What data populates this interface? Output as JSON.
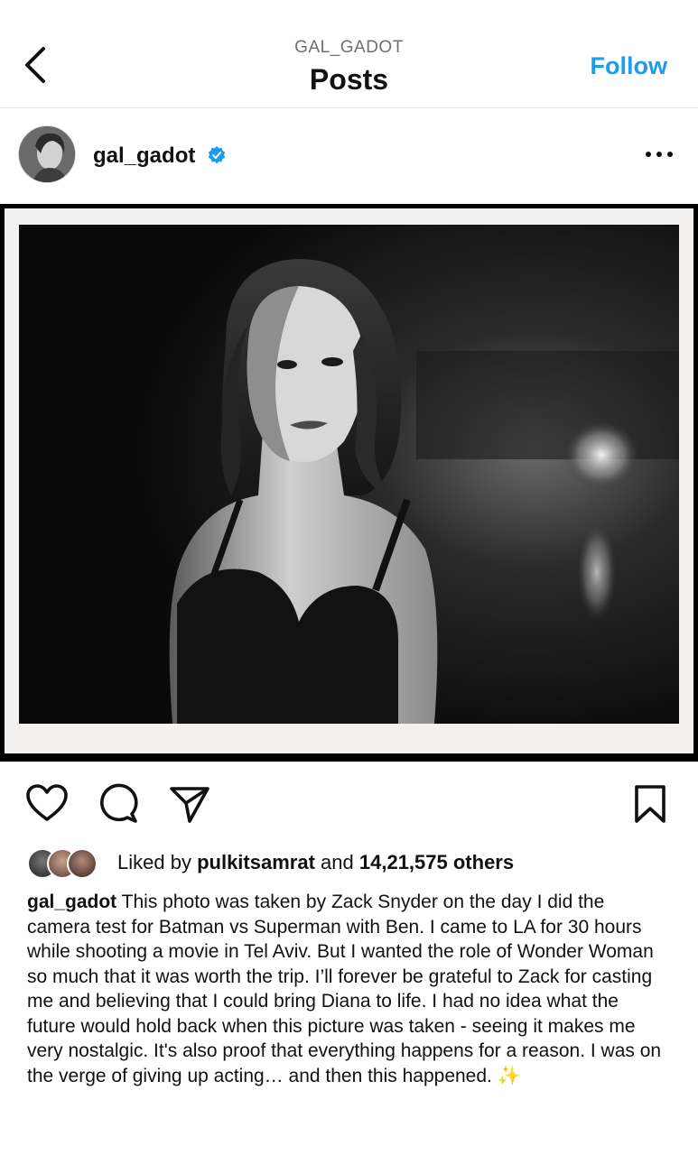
{
  "header": {
    "subtitle": "GAL_GADOT",
    "title": "Posts",
    "follow_label": "Follow"
  },
  "post": {
    "username": "gal_gadot",
    "verified": true,
    "photo_alt": "Black and white portrait photo"
  },
  "actions": {
    "icons": [
      "heart-icon",
      "comment-icon",
      "share-icon",
      "bookmark-icon"
    ]
  },
  "likes": {
    "prefix": "Liked by",
    "liker": "pulkitsamrat",
    "and": "and",
    "others": "14,21,575 others"
  },
  "caption": {
    "username": "gal_gadot",
    "text": "This photo was taken by Zack Snyder on the day I did the camera test for Batman vs Superman with Ben.  I came to LA for 30 hours while shooting a movie in Tel Aviv. But I wanted the role of Wonder Woman so much that it was worth the trip. I’ll forever be grateful to Zack for casting me and believing that I could bring Diana to life. I had no idea what the future would hold back when this picture was taken - seeing it makes me very nostalgic. It's also proof that everything happens for a reason. I was on the verge of giving up acting… and then this happened.",
    "emoji": "✨"
  },
  "colors": {
    "accent": "#1d9bf0",
    "verified": "#1d9bf0"
  }
}
